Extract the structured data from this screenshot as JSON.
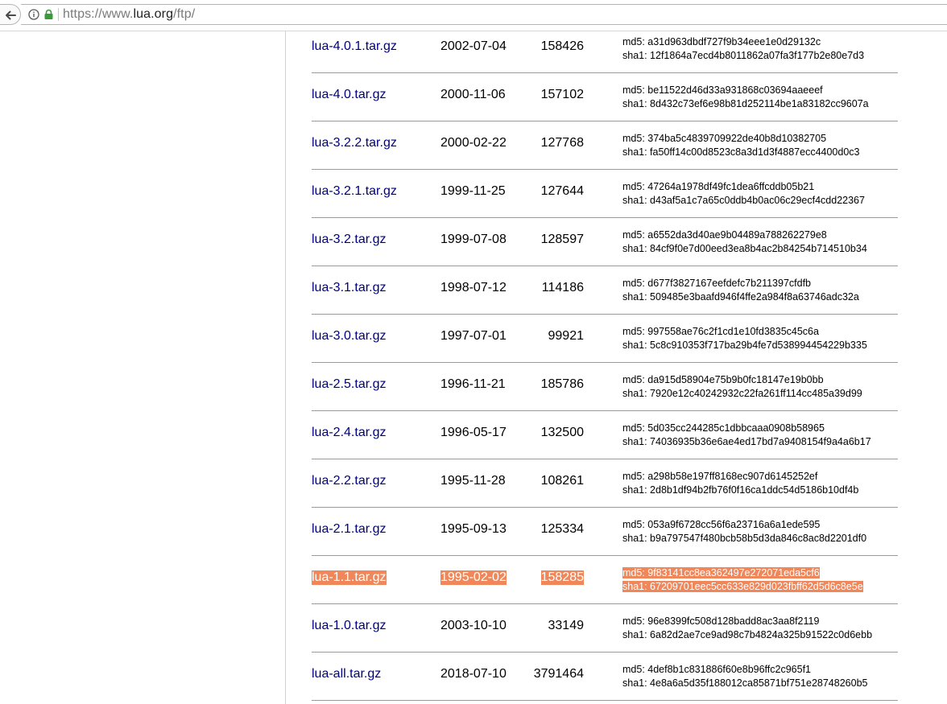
{
  "browser": {
    "url_prefix": "https://www.",
    "url_host": "lua.org",
    "url_path": "/ftp/",
    "back_icon": "back-arrow-icon",
    "info_icon": "info-icon",
    "lock_icon": "lock-icon",
    "lock_color": "#3a9a3a"
  },
  "highlight_color": "#f0875a",
  "files": [
    {
      "name": "lua-4.0.1.tar.gz",
      "date": "2002-07-04",
      "size": "158426",
      "md5": "md5: a31d963dbdf727f9b34eee1e0d29132c",
      "sha1": "sha1: 12f1864a7ecd4b8011862a07fa3f177b2e80e7d3"
    },
    {
      "name": "lua-4.0.tar.gz",
      "date": "2000-11-06",
      "size": "157102",
      "md5": "md5: be11522d46d33a931868c03694aaeeef",
      "sha1": "sha1: 8d432c73ef6e98b81d252114be1a83182cc9607a"
    },
    {
      "name": "lua-3.2.2.tar.gz",
      "date": "2000-02-22",
      "size": "127768",
      "md5": "md5: 374ba5c4839709922de40b8d10382705",
      "sha1": "sha1: fa50ff14c00d8523c8a3d1d3f4887ecc4400d0c3"
    },
    {
      "name": "lua-3.2.1.tar.gz",
      "date": "1999-11-25",
      "size": "127644",
      "md5": "md5: 47264a1978df49fc1dea6ffcddb05b21",
      "sha1": "sha1: d43af5a1c7a65c0ddb4b0ac06c29ecf4cdd22367"
    },
    {
      "name": "lua-3.2.tar.gz",
      "date": "1999-07-08",
      "size": "128597",
      "md5": "md5: a6552da3d40ae9b04489a788262279e8",
      "sha1": "sha1: 84cf9f0e7d00eed3ea8b4ac2b84254b714510b34"
    },
    {
      "name": "lua-3.1.tar.gz",
      "date": "1998-07-12",
      "size": "114186",
      "md5": "md5: d677f3827167eefdefc7b211397cfdfb",
      "sha1": "sha1: 509485e3baafd946f4ffe2a984f8a63746adc32a"
    },
    {
      "name": "lua-3.0.tar.gz",
      "date": "1997-07-01",
      "size": "99921",
      "md5": "md5: 997558ae76c2f1cd1e10fd3835c45c6a",
      "sha1": "sha1: 5c8c910353f717ba29b4fe7d538994454229b335"
    },
    {
      "name": "lua-2.5.tar.gz",
      "date": "1996-11-21",
      "size": "185786",
      "md5": "md5: da915d58904e75b9b0fc18147e19b0bb",
      "sha1": "sha1: 7920e12c40242932c22fa261ff114cc485a39d99"
    },
    {
      "name": "lua-2.4.tar.gz",
      "date": "1996-05-17",
      "size": "132500",
      "md5": "md5: 5d035cc244285c1dbbcaaa0908b58965",
      "sha1": "sha1: 74036935b36e6ae4ed17bd7a9408154f9a4a6b17"
    },
    {
      "name": "lua-2.2.tar.gz",
      "date": "1995-11-28",
      "size": "108261",
      "md5": "md5: a298b58e197ff8168ec907d6145252ef",
      "sha1": "sha1: 2d8b1df94b2fb76f0f16ca1ddc54d5186b10df4b"
    },
    {
      "name": "lua-2.1.tar.gz",
      "date": "1995-09-13",
      "size": "125334",
      "md5": "md5: 053a9f6728cc56f6a23716a6a1ede595",
      "sha1": "sha1: b9a797547f480bcb58b5d3da846c8ac8d2201df0"
    },
    {
      "name": "lua-1.1.tar.gz",
      "date": "1995-02-02",
      "size": "158285",
      "md5": "md5: 9f83141cc8ea362497e272071eda5cf6",
      "sha1": "sha1: 67209701eec5cc633e829d023fbff62d5d6c8e5e",
      "selected": true
    },
    {
      "name": "lua-1.0.tar.gz",
      "date": "2003-10-10",
      "size": "33149",
      "md5": "md5: 96e8399fc508d128badd8ac3aa8f2119",
      "sha1": "sha1: 6a82d2ae7ce9ad98c7b4824a325b91522c0d6ebb"
    },
    {
      "name": "lua-all.tar.gz",
      "date": "2018-07-10",
      "size": "3791464",
      "md5": "md5: 4def8b1c831886f60e8b96ffc2c965f1",
      "sha1": "sha1: 4e8a6a5d35f188012ca85871bf751e28748260b5"
    }
  ]
}
